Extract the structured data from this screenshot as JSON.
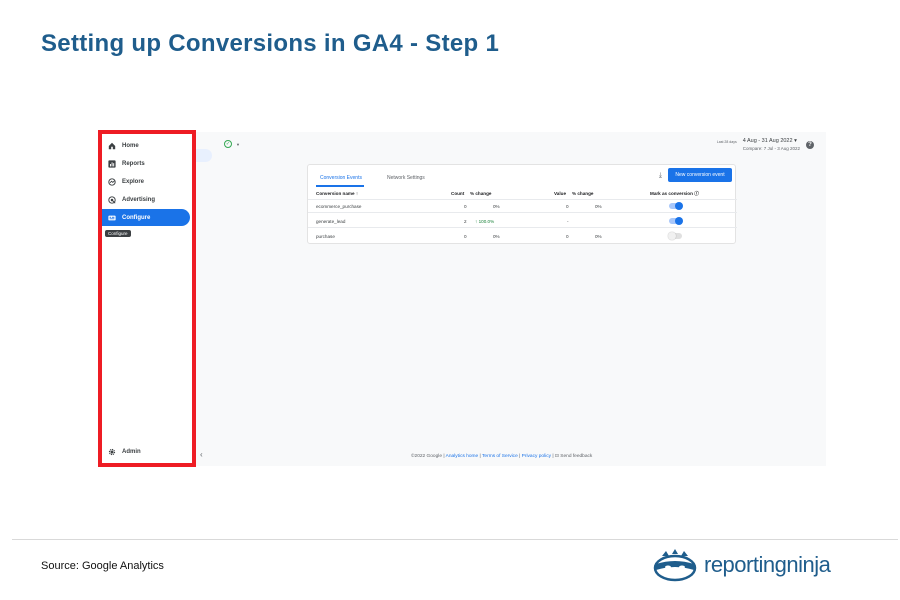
{
  "slide": {
    "title": "Setting up Conversions in GA4 - Step 1",
    "source": "Source: Google Analytics",
    "logo_text": "reportingninja"
  },
  "nav": {
    "items": [
      {
        "label": "Home",
        "icon": "home-icon"
      },
      {
        "label": "Reports",
        "icon": "reports-icon"
      },
      {
        "label": "Explore",
        "icon": "explore-icon"
      },
      {
        "label": "Advertising",
        "icon": "advertising-icon"
      },
      {
        "label": "Configure",
        "icon": "configure-icon",
        "active": true
      }
    ],
    "tooltip": "Configure",
    "admin_label": "Admin"
  },
  "header": {
    "date_label": "Last 28 days",
    "date_range": "4 Aug - 31 Aug 2022",
    "compare": "Compare: 7 Jul - 3 Aug 2022"
  },
  "card": {
    "tabs": [
      "Conversion Events",
      "Network Settings"
    ],
    "new_button": "New conversion event",
    "columns": {
      "name": "Conversion name ↑",
      "count": "Count",
      "count_change": "% change",
      "value": "Value",
      "value_change": "% change",
      "mark": "Mark as conversion"
    },
    "rows": [
      {
        "name": "ecommerce_purchase",
        "count": "0",
        "count_change": "0%",
        "value": "0",
        "value_change": "0%",
        "marked": true
      },
      {
        "name": "generate_lead",
        "count": "2",
        "count_change": "100.0%",
        "value": "-",
        "value_change": "",
        "marked": true
      },
      {
        "name": "purchase",
        "count": "0",
        "count_change": "0%",
        "value": "0",
        "value_change": "0%",
        "marked": false
      }
    ]
  },
  "footer": {
    "copyright": "©2022 Google |",
    "analytics_home": "Analytics home",
    "terms": "Terms of Service",
    "privacy": "Privacy policy",
    "feedback": "Send feedback"
  },
  "colors": {
    "accent": "#1a73e8",
    "highlight": "#ee1c24",
    "title": "#1f5d8c"
  }
}
